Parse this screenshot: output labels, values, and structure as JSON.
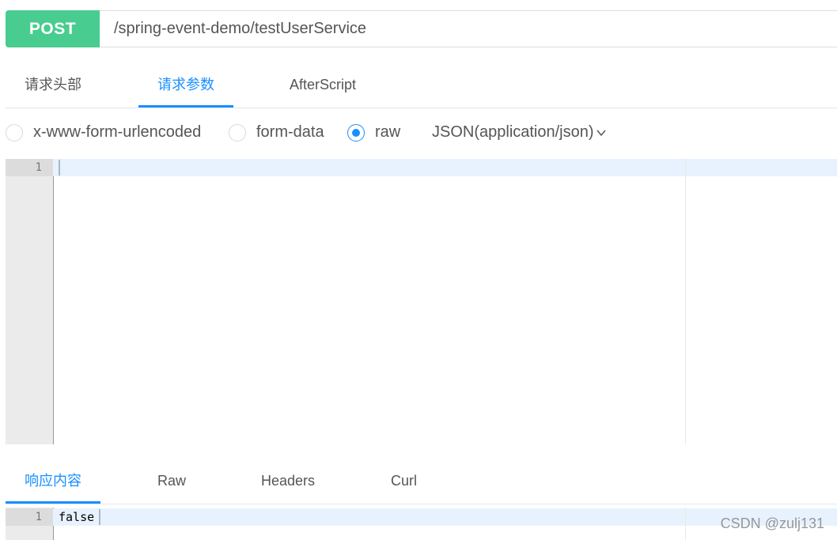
{
  "request": {
    "method": "POST",
    "url": "/spring-event-demo/testUserService"
  },
  "request_tabs": [
    {
      "label": "请求头部",
      "active": false
    },
    {
      "label": "请求参数",
      "active": true
    },
    {
      "label": "AfterScript",
      "active": false
    }
  ],
  "body_types": [
    {
      "label": "x-www-form-urlencoded",
      "checked": false
    },
    {
      "label": "form-data",
      "checked": false
    },
    {
      "label": "raw",
      "checked": true
    }
  ],
  "content_type": {
    "selected": "JSON(application/json)",
    "icon": "chevron-down-icon"
  },
  "request_editor": {
    "lines": [
      {
        "number": "1",
        "text": ""
      }
    ]
  },
  "response_tabs": [
    {
      "label": "响应内容",
      "active": true
    },
    {
      "label": "Raw",
      "active": false
    },
    {
      "label": "Headers",
      "active": false
    },
    {
      "label": "Curl",
      "active": false
    }
  ],
  "response_editor": {
    "lines": [
      {
        "number": "1",
        "text": "false"
      }
    ]
  },
  "watermark": "CSDN @zulj131",
  "colors": {
    "method_post": "#49cc90",
    "accent": "#1890ff",
    "active_line": "#e8f2fe"
  }
}
